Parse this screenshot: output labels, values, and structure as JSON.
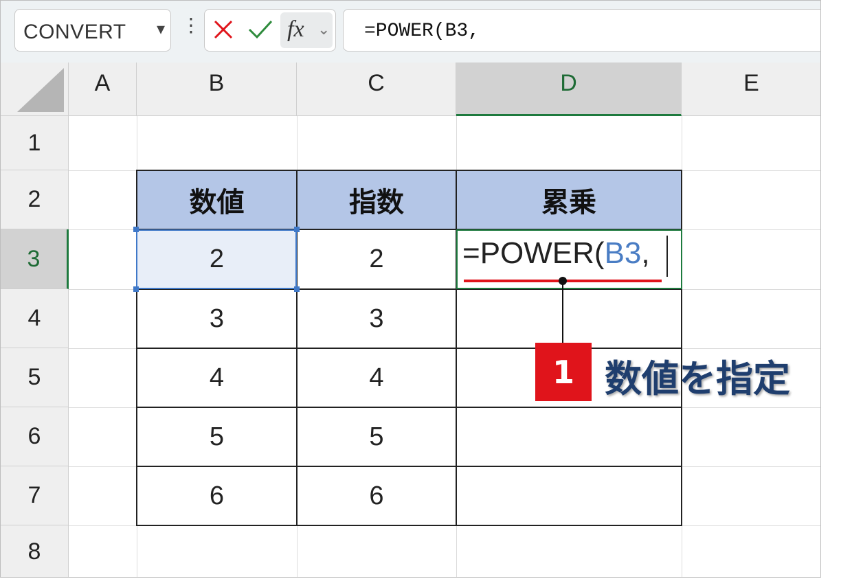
{
  "name_box": {
    "value": "CONVERT",
    "chevron": "▾"
  },
  "formula_bar": {
    "menu_glyph": "⋮",
    "fx_label": "fx",
    "fx_chevron": "⌄",
    "formula": "=POWER(B3,",
    "icons": {
      "cancel": "cancel-x-icon",
      "enter": "enter-check-icon",
      "insert_function": "fx-icon"
    },
    "colors": {
      "cancel": "#e0141b",
      "enter": "#2e8b3c"
    }
  },
  "columns": [
    "A",
    "B",
    "C",
    "D",
    "E"
  ],
  "selected_column": "D",
  "rows": [
    "1",
    "2",
    "3",
    "4",
    "5",
    "6",
    "7",
    "8"
  ],
  "selected_row": "3",
  "table": {
    "headers": [
      "数値",
      "指数",
      "累乗"
    ],
    "rows": [
      [
        "2",
        "2",
        ""
      ],
      [
        "3",
        "3",
        ""
      ],
      [
        "4",
        "4",
        ""
      ],
      [
        "5",
        "5",
        ""
      ],
      [
        "6",
        "6",
        ""
      ]
    ],
    "header_color": "#b4c6e7"
  },
  "editing_cell": {
    "address": "D3",
    "text_prefix": "=POWER(",
    "text_ref": "B3",
    "text_suffix": ",",
    "ref_color": "#4a7dc4"
  },
  "selected_reference": "B3",
  "annotation": {
    "step": "1",
    "text": "数値を指定",
    "badge_color": "#e0141b",
    "text_color": "#1f3e6e"
  }
}
